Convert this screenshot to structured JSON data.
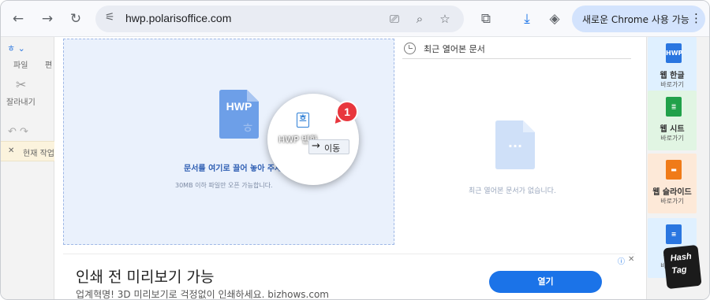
{
  "browser": {
    "url": "hwp.polarisoffice.com",
    "chrome_pill_label": "새로운 Chrome 사용 가능"
  },
  "left_panel": {
    "tab_file": "파일",
    "tab_edit": "편",
    "cut_label": "잘라내기",
    "notice": "현재 작업"
  },
  "upload": {
    "drop_title": "문서를 여기로 끌어 놓아 주세요",
    "drop_subtitle": "30MB 이하 파일만 오픈 가능합니다.",
    "file_type_badge": "HWP",
    "file_type_glyph": "ㅎ"
  },
  "recent": {
    "title": "최근 열어본 문서",
    "empty_text": "최근 열어본 문서가 없습니다.",
    "doc_dots": "···"
  },
  "drag_zoom": {
    "file_icon_glyph": "흐",
    "file_label": "HWP 변환",
    "move_label": "이동",
    "step_number": "1"
  },
  "app_rail": [
    {
      "icon_text": "HWP",
      "name": "웹 한글",
      "shortcut": "바로가기",
      "color": "#2a76e0",
      "bg": "#dff0ff"
    },
    {
      "icon_text": "≣",
      "name": "웹 시트",
      "shortcut": "바로가기",
      "color": "#21a14a",
      "bg": "#e1f5e3"
    },
    {
      "icon_text": "▬",
      "name": "웹 슬라이드",
      "shortcut": "바로가기",
      "color": "#f07b18",
      "bg": "#fde9d8"
    },
    {
      "icon_text": "≡",
      "name": "웹 워",
      "shortcut": "바로가기",
      "color": "#2a76e0",
      "bg": "#dff0ff"
    }
  ],
  "ad": {
    "headline": "인쇄 전 미리보기 가능",
    "description": "업계혁명! 3D 미리보기로 걱정없이 인쇄하세요. bizhows.com",
    "cta": "열기"
  },
  "watermark": {
    "line1": "Hash",
    "line2": "Tag"
  }
}
